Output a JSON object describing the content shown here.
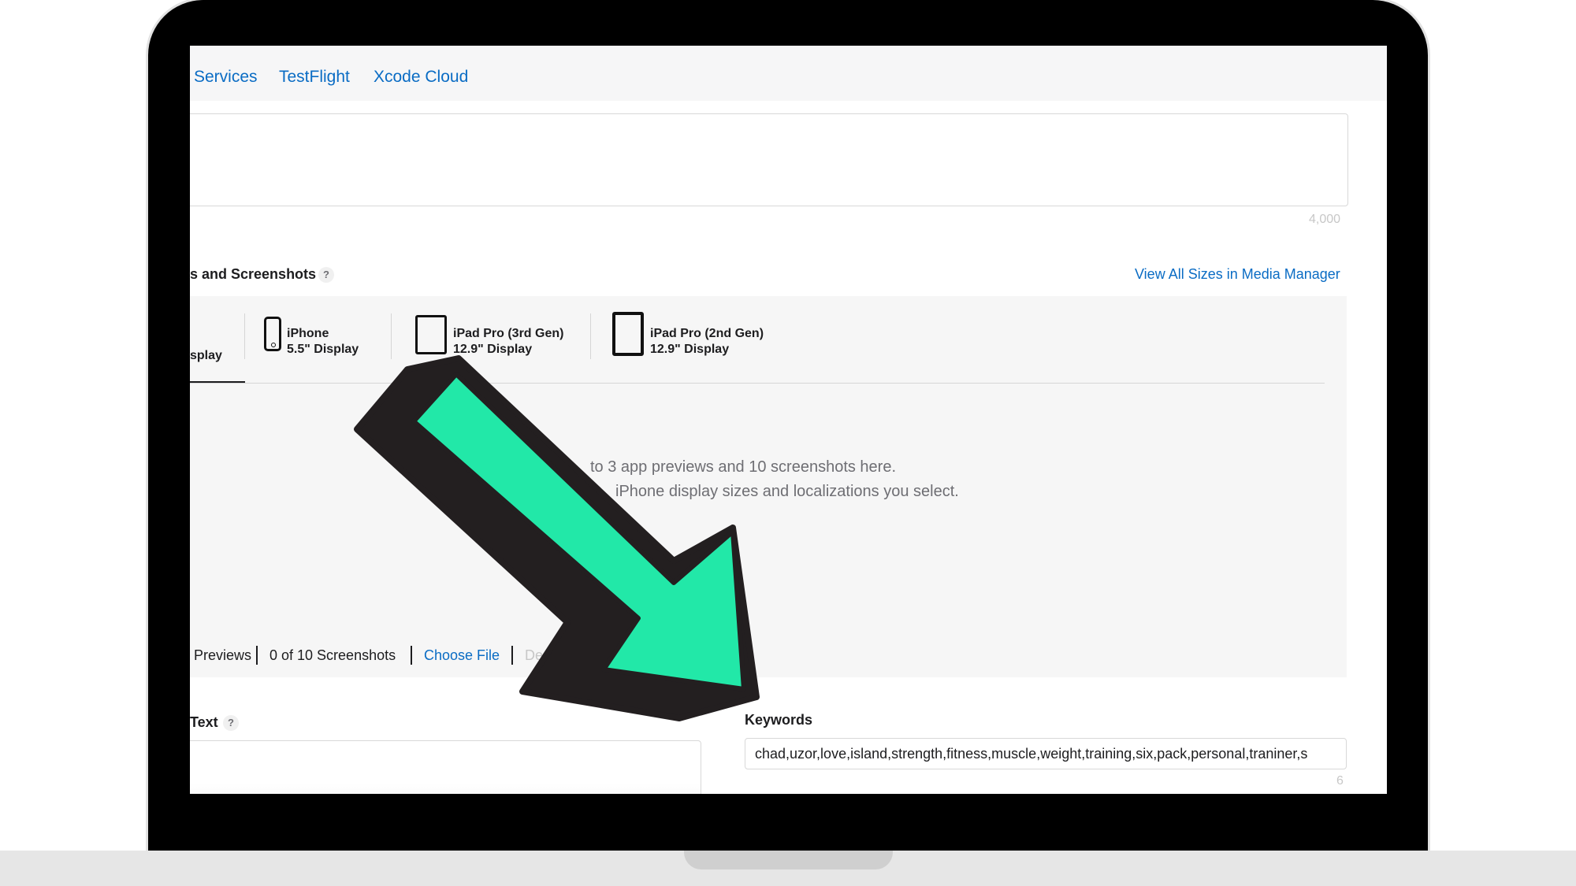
{
  "nav": {
    "items": [
      {
        "label": "Services"
      },
      {
        "label": "TestFlight"
      },
      {
        "label": "Xcode Cloud"
      }
    ]
  },
  "description": {
    "char_limit": "4,000"
  },
  "media": {
    "section_title": "s and Screenshots",
    "help": "?",
    "view_all_link": "View All Sizes in Media Manager",
    "tabs": [
      {
        "label": "splay"
      },
      {
        "label": "iPhone\n5.5\" Display"
      },
      {
        "label": "iPad Pro (3rd Gen)\n12.9\" Display"
      },
      {
        "label": "iPad Pro (2nd Gen)\n12.9\" Display"
      }
    ],
    "drop_text_1": "to 3 app previews and 10 screenshots here.",
    "drop_text_2": "iPhone display sizes and localizations you select.",
    "previews_count": "Previews",
    "screenshots_count": "0 of 10 Screenshots",
    "choose_file": "Choose File",
    "delete_all": "De"
  },
  "promo": {
    "label": "Text",
    "help": "?"
  },
  "keywords": {
    "label": "Keywords",
    "value": "chad,uzor,love,island,strength,fitness,muscle,weight,training,six,pack,personal,traniner,s",
    "remaining": "6"
  },
  "colors": {
    "link": "#0a6cc4",
    "arrow_fill": "#22e8a8",
    "arrow_shadow": "#231f20"
  }
}
